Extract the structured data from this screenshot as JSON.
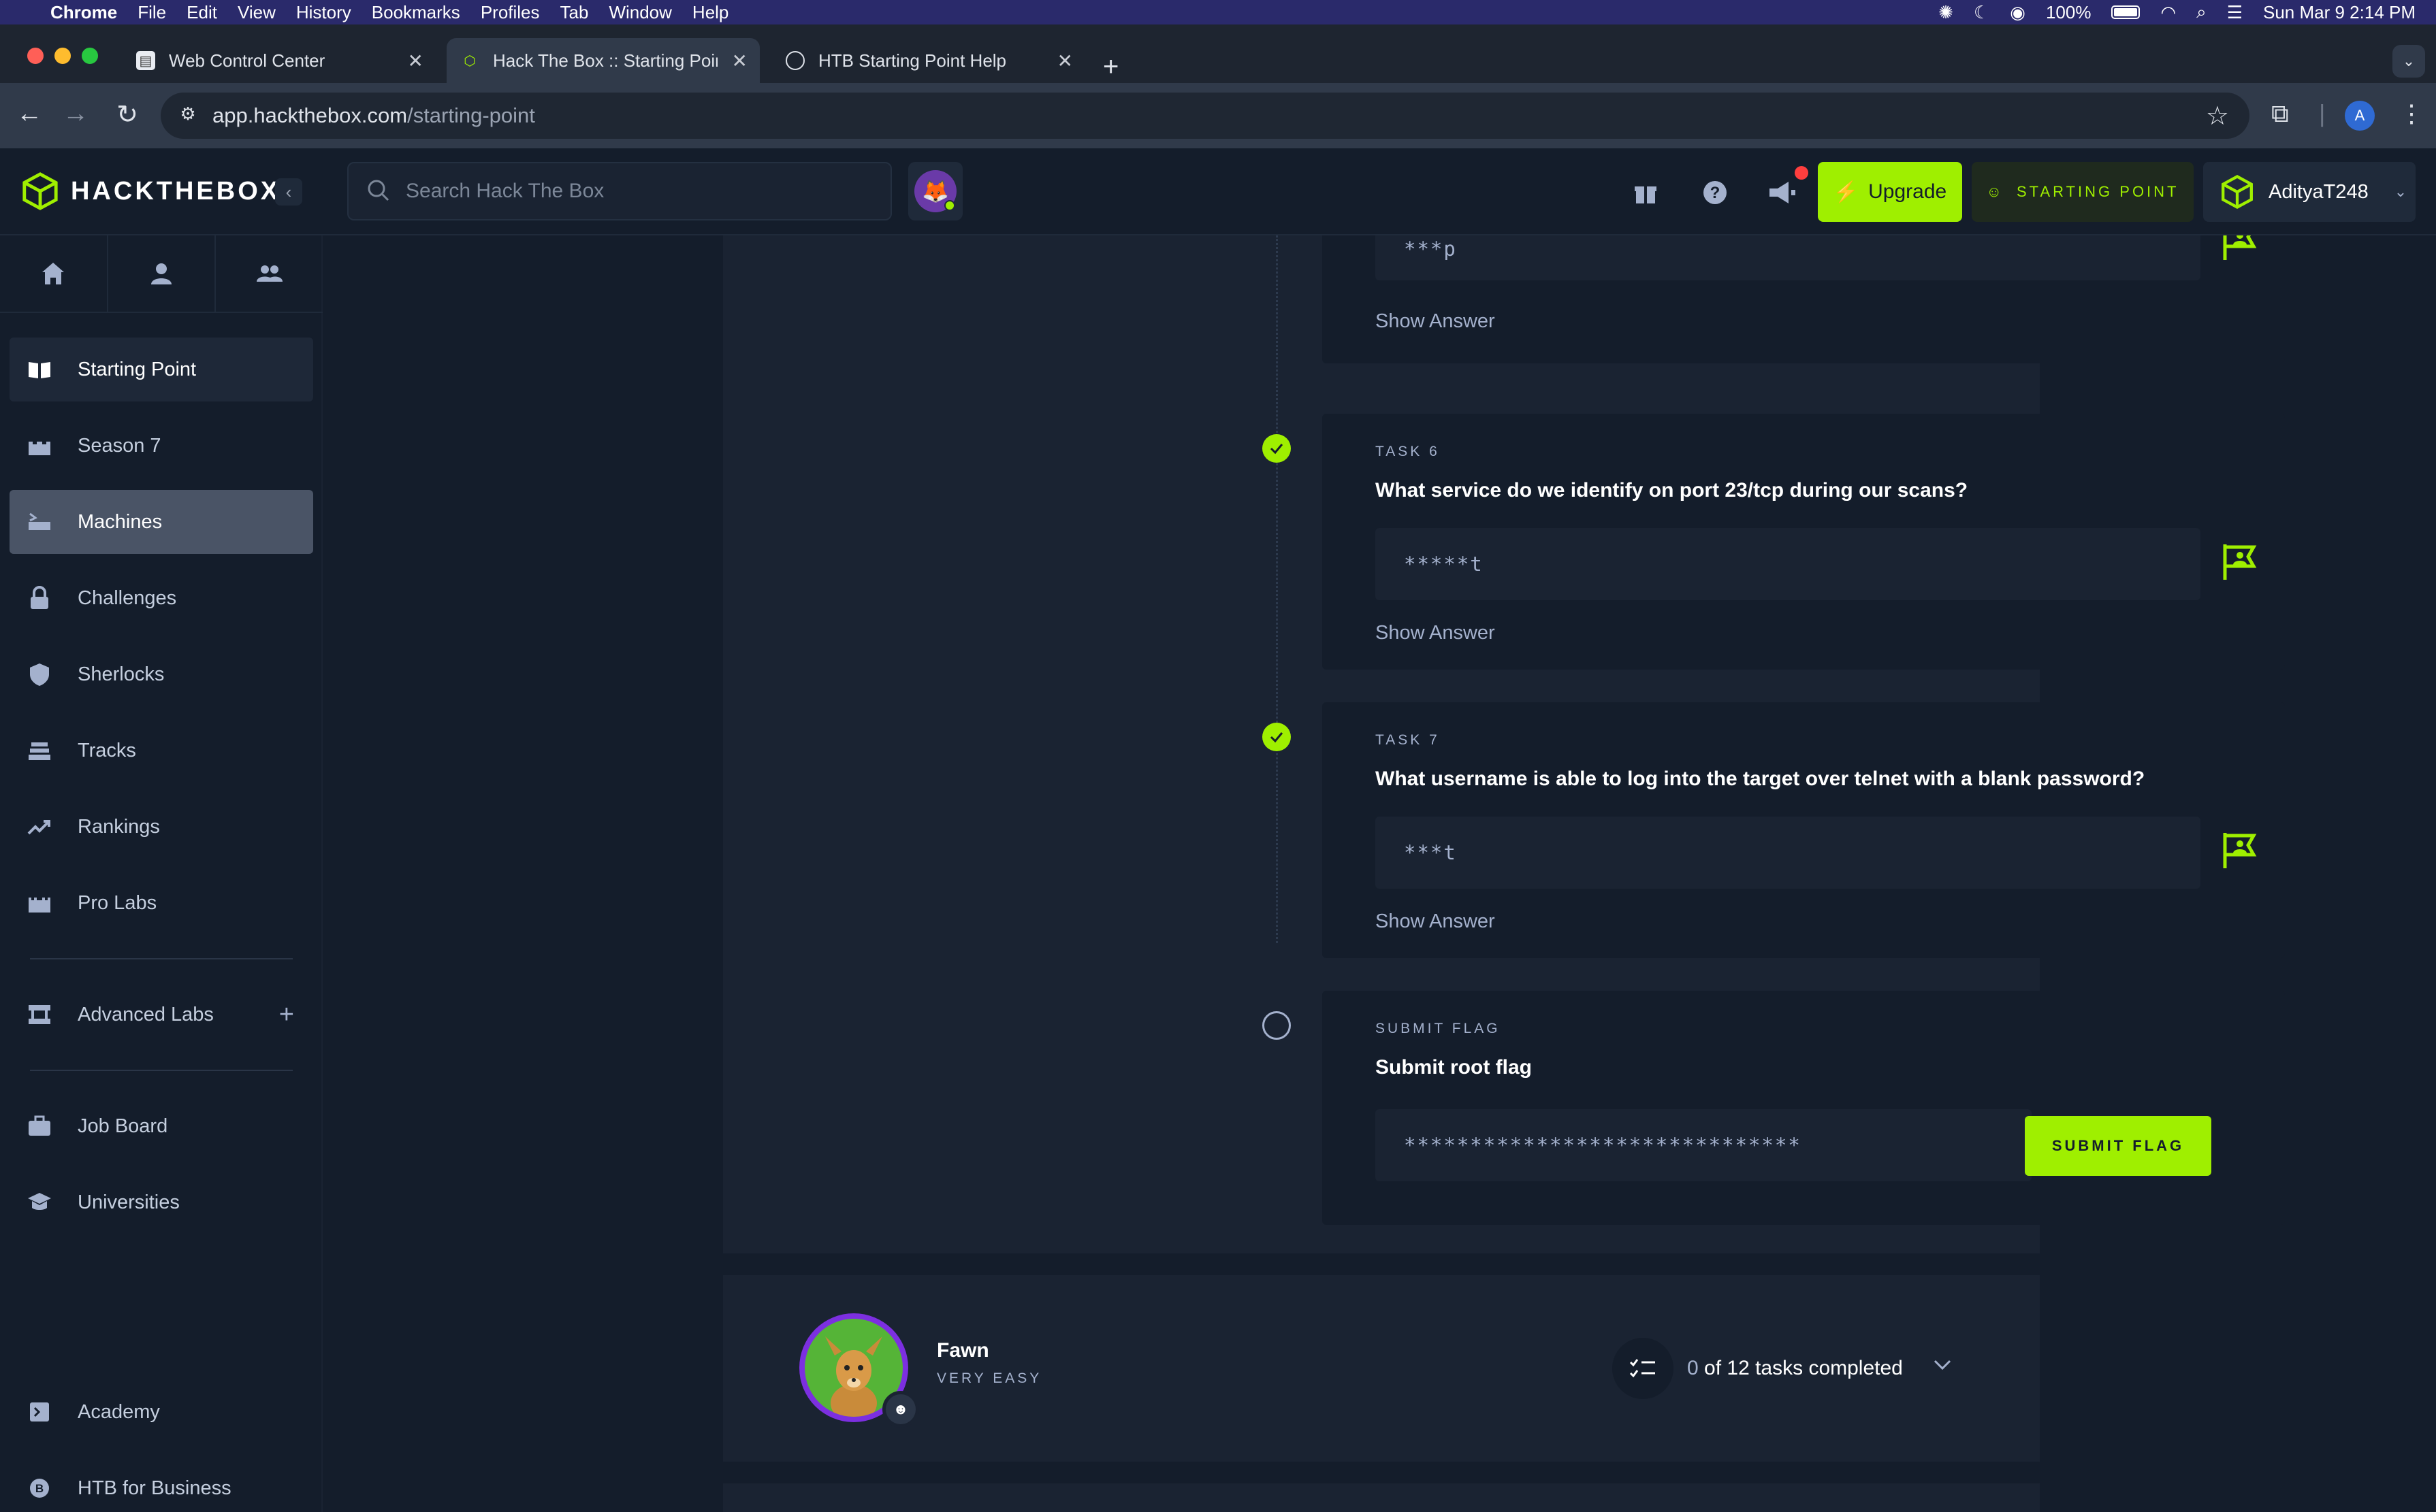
{
  "menubar": {
    "app": "Chrome",
    "items": [
      "File",
      "Edit",
      "View",
      "History",
      "Bookmarks",
      "Profiles",
      "Tab",
      "Window",
      "Help"
    ],
    "battery": "100%",
    "datetime": "Sun Mar 9  2:14 PM"
  },
  "tabs": [
    {
      "title": "Web Control Center"
    },
    {
      "title": "Hack The Box :: Starting Point"
    },
    {
      "title": "HTB Starting Point Help"
    }
  ],
  "omnibox": {
    "host": "app.hackthebox.com",
    "path": "/starting-point"
  },
  "profile_initial": "A",
  "htb": {
    "logo_bold": "HACKTHE",
    "logo_light": "BOX",
    "search_placeholder": "Search Hack The Box",
    "upgrade_label": "Upgrade",
    "starting_point_label": "STARTING POINT",
    "username": "AdityaT248"
  },
  "sidebar": {
    "items": [
      {
        "label": "Starting Point",
        "icon": "book-open-icon"
      },
      {
        "label": "Season 7",
        "icon": "castle-icon"
      },
      {
        "label": "Machines",
        "icon": "server-icon"
      },
      {
        "label": "Challenges",
        "icon": "lock-icon"
      },
      {
        "label": "Sherlocks",
        "icon": "shield-icon"
      },
      {
        "label": "Tracks",
        "icon": "layers-icon"
      },
      {
        "label": "Rankings",
        "icon": "trending-up-icon"
      },
      {
        "label": "Pro Labs",
        "icon": "fortress-icon"
      },
      {
        "label": "Advanced Labs",
        "icon": "network-icon"
      },
      {
        "label": "Job Board",
        "icon": "briefcase-icon"
      },
      {
        "label": "Universities",
        "icon": "graduation-cap-icon"
      },
      {
        "label": "Academy",
        "icon": "terminal-icon"
      },
      {
        "label": "HTB for Business",
        "icon": "b-circle-icon"
      }
    ]
  },
  "tasks": [
    {
      "answer_mask": "***p",
      "show_answer": "Show Answer"
    },
    {
      "label": "TASK 6",
      "question": "What service do we identify on port 23/tcp during our scans?",
      "answer_mask": "*****t",
      "show_answer": "Show Answer"
    },
    {
      "label": "TASK 7",
      "question": "What username is able to log into the target over telnet with a blank password?",
      "answer_mask": "***t",
      "show_answer": "Show Answer"
    }
  ],
  "submit": {
    "label": "SUBMIT FLAG",
    "question": "Submit root flag",
    "value": "******************************",
    "button": "SUBMIT FLAG"
  },
  "machine": {
    "name": "Fawn",
    "difficulty": "VERY EASY",
    "tasks_done": "0",
    "tasks_text": "of 12 tasks completed"
  },
  "colors": {
    "accent": "#9fef00",
    "bg": "#141d2b",
    "panel": "#1a2332"
  }
}
